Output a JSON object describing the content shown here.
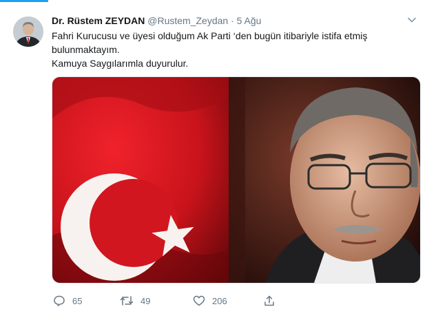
{
  "tweet": {
    "author_name": "Dr. Rüstem ZEYDAN",
    "handle": "@Rustem_Zeydan",
    "separator": " · ",
    "date": "5 Ağu",
    "text_lines": [
      "Fahri Kurucusu ve üyesi olduğum Ak Parti ‘den bugün itibariyle istifa etmiş",
      "bulunmaktayım.",
      "Kamuya Saygılarımla duyurulur."
    ],
    "media": {
      "left_image": "turkish-flag",
      "right_image": "portrait-photo"
    }
  },
  "actions": {
    "replies": "65",
    "retweets": "49",
    "likes": "206"
  },
  "icons": {
    "reply": "reply-icon",
    "retweet": "retweet-icon",
    "like": "like-icon",
    "share": "share-icon",
    "menu": "chevron-down-icon"
  },
  "colors": {
    "accent": "#1da1f2",
    "meta_text": "#657786",
    "flag_red": "#d41820"
  }
}
